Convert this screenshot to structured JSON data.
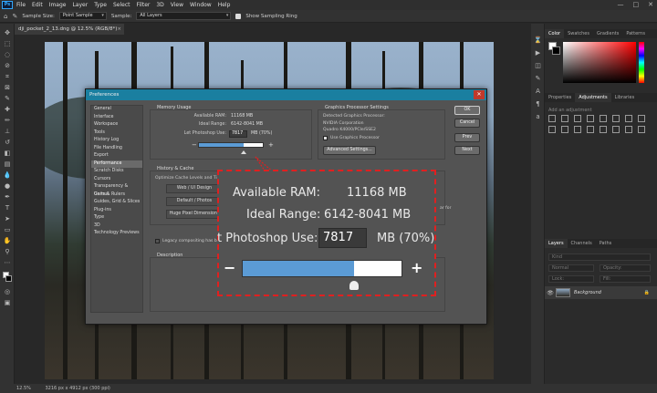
{
  "menubar": {
    "logo": "Ps",
    "items": [
      "File",
      "Edit",
      "Image",
      "Layer",
      "Type",
      "Select",
      "Filter",
      "3D",
      "View",
      "Window",
      "Help"
    ],
    "window_controls": [
      "—",
      "□",
      "✕"
    ]
  },
  "options": {
    "sample_size_label": "Sample Size:",
    "sample_size_value": "Point Sample",
    "sample_label": "Sample:",
    "sample_value": "All Layers",
    "show_ring_label": "Show Sampling Ring"
  },
  "document_tab": {
    "title": "dji_pocket_2_13.dng @ 12.5% (RGB/8*)",
    "close": "×"
  },
  "statusbar": {
    "zoom": "12.5%",
    "doc_size": "3216 px x 4912 px (300 ppi)"
  },
  "panels": {
    "top_tabs": [
      "Color",
      "Swatches",
      "Gradients",
      "Patterns"
    ],
    "mid_tabs": [
      "Properties",
      "Adjustments",
      "Libraries"
    ],
    "adjustments_hint": "Add an adjustment",
    "layer_tabs": [
      "Layers",
      "Channels",
      "Paths"
    ],
    "layers_kind": "Kind",
    "layers_blend": "Normal",
    "layers_opacity": "Opacity:",
    "layers_lock": "Lock:",
    "layers_fill": "Fill:",
    "layer_name": "Background"
  },
  "dialog": {
    "title": "Preferences",
    "close": "✕",
    "categories": [
      "General",
      "Interface",
      "Workspace",
      "Tools",
      "History Log",
      "File Handling",
      "Export",
      "Performance",
      "Scratch Disks",
      "Cursors",
      "Transparency & Gamut",
      "Units & Rulers",
      "Guides, Grid & Slices",
      "Plug-ins",
      "Type",
      "3D",
      "Technology Previews"
    ],
    "active_category": "Performance",
    "memory": {
      "title": "Memory Usage",
      "available_label": "Available RAM:",
      "available_value": "11168 MB",
      "ideal_label": "Ideal Range:",
      "ideal_value": "6142-8041 MB",
      "let_label": "Let Photoshop Use:",
      "let_value": "7817",
      "let_unit": "MB (70%)",
      "usage_fraction": 0.7,
      "minus": "−",
      "plus": "+"
    },
    "gpu": {
      "title": "Graphics Processor Settings",
      "detected_label": "Detected Graphics Processor:",
      "vendor": "NVIDIA Corporation",
      "model": "Quadro K4000/PCIe/SSE2",
      "use_label": "Use Graphics Processor",
      "advanced_button": "Advanced Settings..."
    },
    "history": {
      "title": "History & Cache",
      "optimize_label": "Optimize Cache Levels and Tile Size for:",
      "buttons": [
        "Web / UI Design",
        "Default / Photos",
        "Huge Pixel Dimensions"
      ],
      "note": "ar for"
    },
    "legacy_label": "Legacy compositing has been",
    "description_title": "Description",
    "buttons": {
      "ok": "OK",
      "cancel": "Cancel",
      "prev": "Prev",
      "next": "Next"
    }
  },
  "zoom_callout": {
    "available_label": "Available RAM:",
    "available_value": "11168 MB",
    "ideal_label": "Ideal Range:",
    "ideal_value": "6142-8041 MB",
    "let_label": "t Photoshop Use:",
    "let_value": "7817",
    "let_unit": "MB (70%)",
    "minus": "−",
    "plus": "+",
    "accent": "#e02020",
    "fill_color": "#5b9bd5"
  }
}
